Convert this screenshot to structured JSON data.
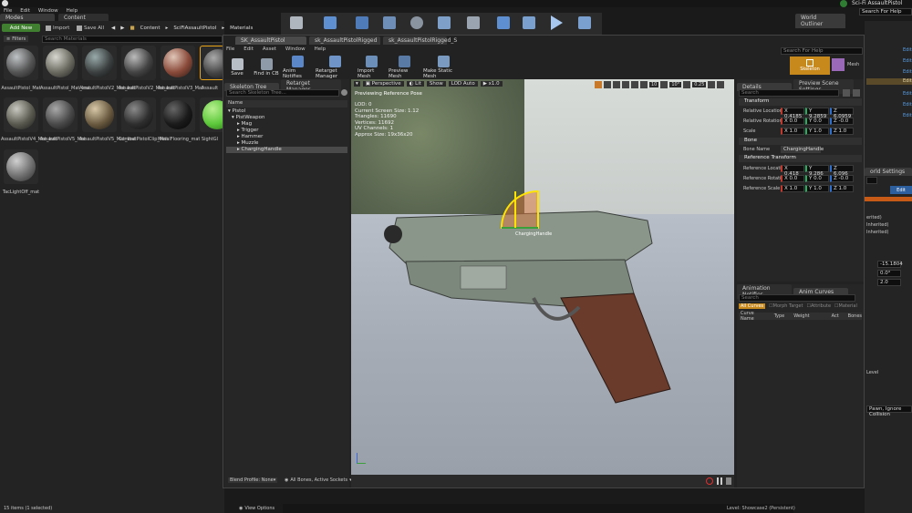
{
  "main_window": {
    "title": "Sci-Fi AssaultPistol",
    "menu": [
      "File",
      "Edit",
      "Window",
      "Help"
    ],
    "modes_tab": "Modes",
    "content_browser_tab": "Content Browser",
    "world_outliner_tab": "World Outliner",
    "search_help": "Search For Help"
  },
  "content_browser": {
    "add_new": "Add New",
    "import": "Import",
    "save_all": "Save All",
    "breadcrumb": [
      "Content",
      "SciFiAssaultPistol",
      "Materials"
    ],
    "filters": "Filters",
    "search_placeholder": "Search Materials",
    "assets": [
      {
        "label": "AssaultPistol_Mat"
      },
      {
        "label": "AssaultPistol_Mat_Inst"
      },
      {
        "label": "AssaultPistolV2_Mat_Inst"
      },
      {
        "label": "AssaultPistolV2_Mat_Inst"
      },
      {
        "label": "AssaultPistolV3_Mat"
      },
      {
        "label": "Assault"
      },
      {
        "label": "AssaultPistolV4_Mat_Inst"
      },
      {
        "label": "AssaultPistolV5_Mat"
      },
      {
        "label": "AssaultPistolV5_Mat_Inst"
      },
      {
        "label": "CombatPistolClip_Mat"
      },
      {
        "label": "MetalFlooring_mat"
      },
      {
        "label": "SightGl"
      },
      {
        "label": "TacLightOff_mat"
      }
    ],
    "status": "15 items (1 selected)",
    "view_options": "View Options"
  },
  "editor": {
    "tabs": [
      "SK_AssaultPistol",
      "sk_AssaultPistolRigged",
      "sk_AssaultPistolRigged_S"
    ],
    "menu": [
      "File",
      "Edit",
      "Asset",
      "Window",
      "Help"
    ],
    "search_help": "Search For Help",
    "toolbar": [
      "Save",
      "Find in CB",
      "Anim Notifies",
      "Retarget Manager",
      "Import Mesh",
      "Preview Mesh",
      "Make Static Mesh"
    ],
    "mode_skeleton": "Skeleton",
    "mode_mesh": "Mesh",
    "skeleton_tree_tab": "Skeleton Tree",
    "retarget_tab": "Retarget Manager",
    "tree_search": "Search Skeleton Tree...",
    "name_header": "Name",
    "bones": [
      "Pistol",
      "PistWeapon",
      "Mag",
      "Trigger",
      "Hammer",
      "Muzzle",
      "ChargingHandle"
    ],
    "blend_profile": "Blend Profile: None",
    "all_bones": "All Bones, Active Sockets",
    "viewport": {
      "perspective": "Perspective",
      "lit": "Lit",
      "show": "Show",
      "lod": "LOD Auto",
      "speed": "x1.0",
      "previewing": "Previewing Reference Pose",
      "stats": [
        "LOD: 0",
        "Current Screen Size: 1.12",
        "Triangles: 11690",
        "Vertices: 11692",
        "UV Channels: 1",
        "Approx Size: 19x36x20"
      ],
      "snap": [
        "10",
        "10°",
        "0.25"
      ],
      "gizmo_label": "ChargingHandle"
    },
    "details": {
      "tab": "Details",
      "preview_tab": "Preview Scene Settings",
      "search": "Search",
      "transform": "Transform",
      "loc_label": "Relative Location",
      "rot_label": "Relative Rotation",
      "scale_label": "Scale",
      "loc": [
        "X 0.4185",
        "Y 9.2859",
        "Z 6.0959"
      ],
      "rot": [
        "X 0.0",
        "Y 0.0",
        "Z -0.0"
      ],
      "scale": [
        "X 1.0",
        "Y 1.0",
        "Z 1.0"
      ],
      "bone": "Bone",
      "bone_name_label": "Bone Name",
      "bone_name": "ChargingHandle",
      "ref_transform": "Reference Transform",
      "ref_loc_label": "Reference Location",
      "ref_rot_label": "Reference Rotation",
      "ref_scale_label": "Reference Scale",
      "ref_loc": [
        "X 0.418",
        "Y 9.286",
        "Z 6.096"
      ],
      "ref_rot": [
        "X 0.0",
        "Y 0.0",
        "Z -0.0"
      ],
      "ref_scale": [
        "X 1.0",
        "Y 1.0",
        "Z 1.0"
      ]
    },
    "anim": {
      "notifies_tab": "Animation Notifies",
      "curves_tab": "Anim Curves",
      "search": "Search",
      "filters": [
        "All Curves",
        "Morph Target",
        "Attribute",
        "Material"
      ],
      "cols": [
        "Curve Name",
        "Type",
        "Weight",
        "Act",
        "Bones"
      ]
    }
  },
  "right_panel": {
    "level": "Level: Showcase2 (Persistent)",
    "world_settings": "orld Settings",
    "edit": "Edit",
    "inherited": [
      "erited)",
      "Inherited)",
      "Inherited)"
    ],
    "vals": [
      "-15.1804",
      "0.0°",
      "2.0"
    ],
    "collision": "Pawn, Ignore Collision"
  },
  "colors": {
    "accent": "#e8a317",
    "green": "#4caf50"
  }
}
